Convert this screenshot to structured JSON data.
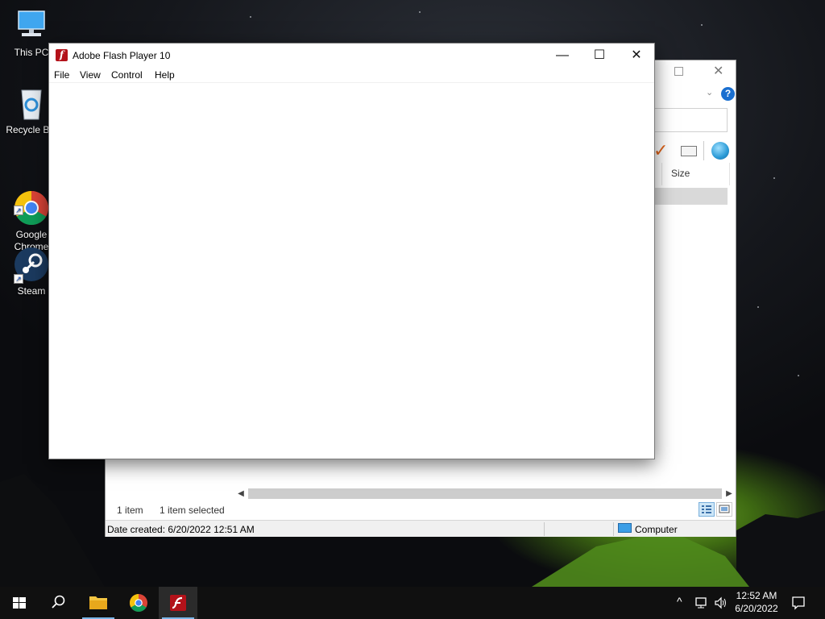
{
  "desktop": {
    "icons": [
      {
        "label": "This PC",
        "icon": "monitor-icon"
      },
      {
        "label": "Recycle Bin",
        "icon": "recycle-bin-icon"
      },
      {
        "label": "Google\nChrome",
        "icon": "chrome-icon"
      },
      {
        "label": "Steam",
        "icon": "steam-icon"
      }
    ]
  },
  "flash_window": {
    "title": "Adobe Flash Player 10",
    "menu": [
      "File",
      "View",
      "Control",
      "Help"
    ],
    "controls": {
      "minimize": "—",
      "maximize": "☐",
      "close": "✕"
    }
  },
  "explorer_window": {
    "column_size": "Size",
    "status_items": "1 item",
    "status_selected": "1 item selected",
    "details_created": "Date created: 6/20/2022 12:51 AM",
    "details_location": "Computer",
    "help_glyph": "?"
  },
  "taskbar": {
    "apps": [
      {
        "name": "start",
        "icon": "windows-logo-icon"
      },
      {
        "name": "search",
        "icon": "search-icon"
      },
      {
        "name": "file-explorer",
        "icon": "folder-icon"
      },
      {
        "name": "chrome",
        "icon": "chrome-icon"
      },
      {
        "name": "flash-player",
        "icon": "flash-icon",
        "active": true
      }
    ],
    "clock_time": "12:52 AM",
    "clock_date": "6/20/2022",
    "tray_glyphs": {
      "chevron": "^",
      "network": "🖧",
      "volume": "🕪",
      "notifications": "🗨"
    }
  },
  "colors": {
    "flash_red": "#b3121a",
    "accent_blue": "#1a6fd0",
    "taskbar": "#101010"
  }
}
